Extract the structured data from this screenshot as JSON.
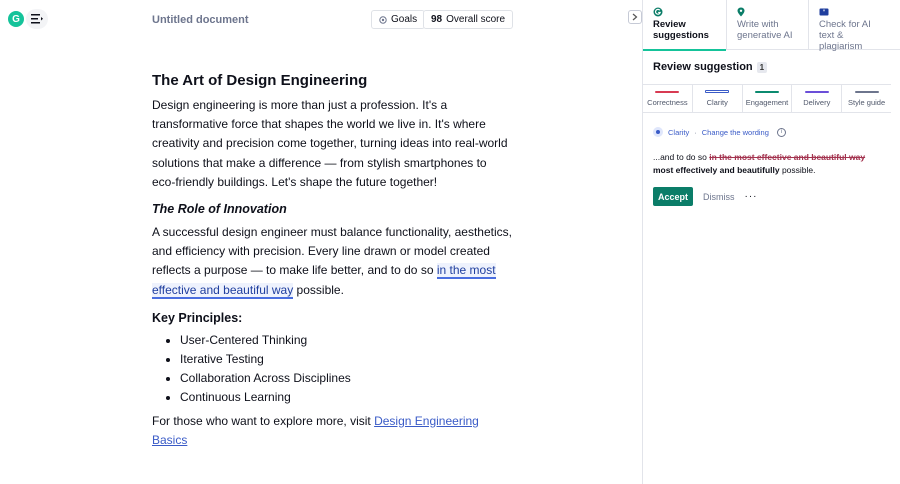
{
  "app": {
    "logo_glyph": "G",
    "doc_title": "Untitled document",
    "goals_label": "Goals",
    "score_value": "98",
    "score_label": "Overall score"
  },
  "document": {
    "heading": "The Art of Design Engineering",
    "intro": "Design engineering is more than just a profession. It's a transformative force that shapes the world we live in. It's where creativity and precision come together, turning ideas into real-world solutions that make a difference — from stylish smartphones to eco-friendly buildings. Let's shape the future together!",
    "subheading": "The Role of Innovation",
    "para2_before": "A successful design engineer must balance functionality, aesthetics, and efficiency with precision. Every line drawn or model created reflects a purpose — to make life better, and to do so ",
    "para2_highlight": "in the most effective and beautiful way",
    "para2_after": " possible.",
    "principles_heading": "Key Principles:",
    "principles": [
      "User-Centered Thinking",
      "Iterative Testing",
      "Collaboration Across Disciplines",
      "Continuous Learning"
    ],
    "closing_before": "For those who want to explore more, visit ",
    "closing_link": "Design Engineering Basics"
  },
  "panel": {
    "tabs": [
      {
        "line1": "Review",
        "line2": "suggestions"
      },
      {
        "line1": "Write with",
        "line2": "generative AI"
      },
      {
        "line1": "Check for AI",
        "line2": "text & plagiarism"
      }
    ],
    "review_title": "Review suggestion",
    "review_count": "1",
    "categories": [
      {
        "label": "Correctness",
        "color": "#d83a52"
      },
      {
        "label": "Clarity",
        "color": "#3a5bc7"
      },
      {
        "label": "Engagement",
        "color": "#0b8a6f"
      },
      {
        "label": "Delivery",
        "color": "#6b4fd8"
      },
      {
        "label": "Style guide",
        "color": "#6d758d"
      }
    ],
    "card": {
      "category": "Clarity",
      "separator": "·",
      "action": "Change the wording",
      "info_glyph": "i",
      "prefix": "...and to do so ",
      "strike": "in the most effective and beautiful way",
      "replacement": "most effectively and beautifully",
      "suffix": " possible.",
      "accept_label": "Accept",
      "dismiss_label": "Dismiss",
      "more_label": "···"
    }
  }
}
